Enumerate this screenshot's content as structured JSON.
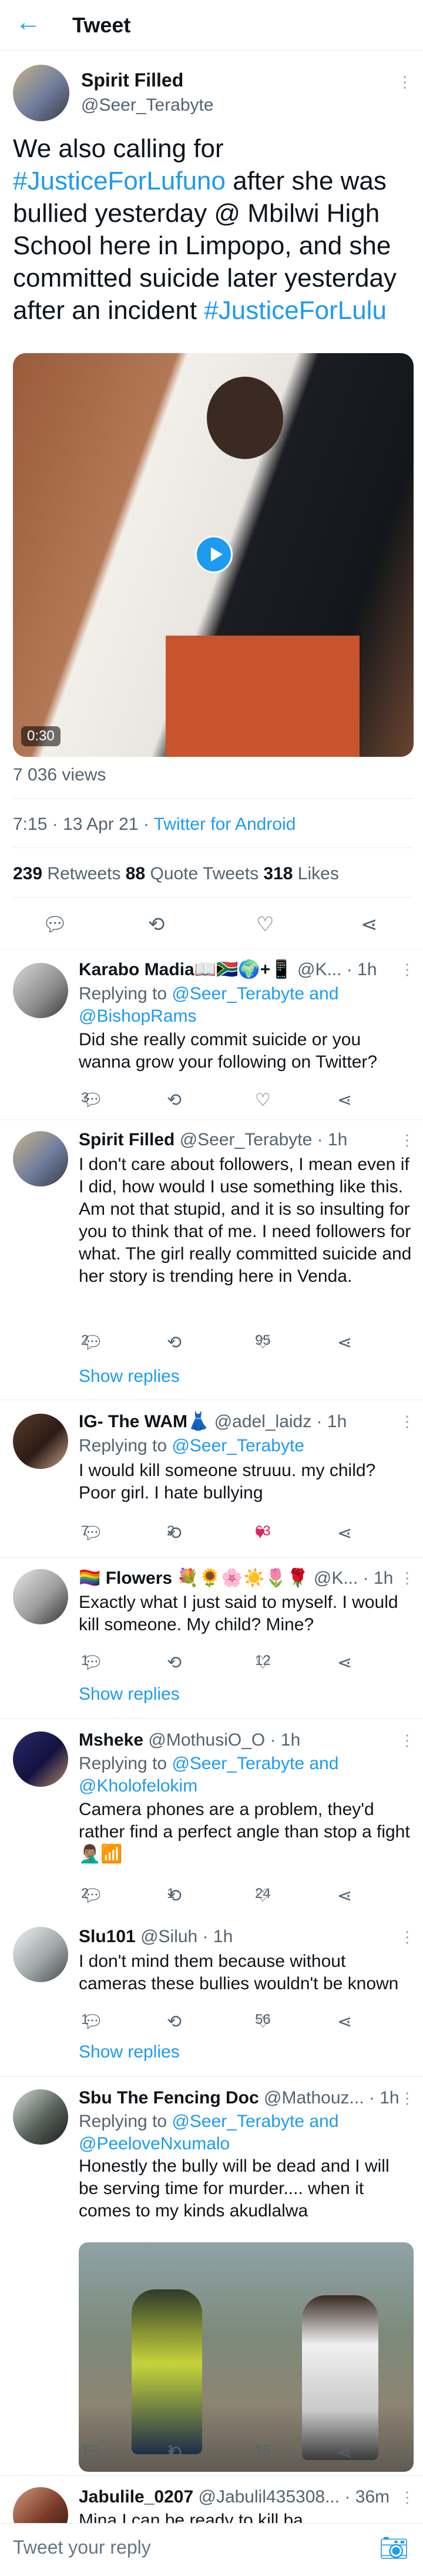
{
  "header": {
    "title": "Tweet",
    "back_icon": "←"
  },
  "tweet": {
    "name": "Spirit Filled",
    "handle": "@Seer_Terabyte",
    "text_parts": [
      "We also calling for ",
      "#JusticeForLufuno",
      " after she was bullied yesterday @ Mbilwi High School here in Limpopo, and she committed suicide later yesterday after an incident ",
      "#JusticeForLulu"
    ],
    "video_duration": "0:30",
    "views": "7 036 views",
    "time": "7:15 · 13 Apr 21 · ",
    "client": "Twitter for Android",
    "retweets": "239",
    "retweets_label": " Retweets  ",
    "quotes": "88",
    "quotes_label": " Quote Tweets  ",
    "likes": "318",
    "likes_label": " Likes"
  },
  "replies": [
    {
      "name": "Karabo Madia📖🇿🇦🌍+📱",
      "handle": "@K... · 1h",
      "replying_prefix": "Replying to ",
      "replying_to": "@Seer_Terabyte and @BishopRams",
      "text": "Did she really commit suicide or you wanna grow your following on Twitter?",
      "reply_count": "3",
      "retweet_count": "",
      "like_count": ""
    },
    {
      "name": "Spirit Filled",
      "handle": "@Seer_Terabyte · 1h",
      "text": "I don't care about followers, I mean even if I did, how would I use something like this. Am not that stupid, and it is so insulting for you to think that of me. I need followers for what. The girl really committed suicide and her story is trending here in Venda.",
      "reply_count": "2",
      "retweet_count": "",
      "like_count": "95",
      "show_replies": "Show replies"
    },
    {
      "name": "IG- The WAM👗",
      "handle": "@adel_laidz · 1h",
      "replying_prefix": "Replying to ",
      "replying_to": "@Seer_Terabyte",
      "text": "I would kill someone struuu. my child? Poor girl. I hate bullying",
      "reply_count": "7",
      "retweet_count": "2",
      "like_count": "63"
    },
    {
      "name": "🏳️‍🌈 Flowers 💐🌻🌸☀️🌷🌹",
      "handle": "@K... · 1h",
      "text": "Exactly what I just said to myself. I would kill someone. My child? Mine?",
      "reply_count": "1",
      "retweet_count": "",
      "like_count": "12",
      "show_replies": "Show replies"
    },
    {
      "name": "Msheke",
      "handle": "@MothusiO_O · 1h",
      "replying_prefix": "Replying to ",
      "replying_to": "@Seer_Terabyte and @Kholofelokim",
      "text": "Camera phones are a problem, they'd rather find a perfect angle than stop a fight 🤦🏽‍♂️📶",
      "reply_count": "2",
      "retweet_count": "1",
      "like_count": "24"
    },
    {
      "name": "Slu101",
      "handle": "@Siluh · 1h",
      "text": "I don't mind them because without cameras these bullies wouldn't be known",
      "reply_count": "1",
      "retweet_count": "",
      "like_count": "56",
      "show_replies": "Show replies"
    },
    {
      "name": "Sbu The Fencing Doc",
      "handle": "@Mathouz... · 1h",
      "replying_prefix": "Replying to ",
      "replying_to": "@Seer_Terabyte and @PeeloveNxumalo",
      "text": "Honestly the bully will be dead and I will be serving time for murder.... when it comes to my kinds akudlalwa",
      "reply_count": "1",
      "retweet_count": "1",
      "like_count": "15"
    },
    {
      "name": "Jabulile_0207",
      "handle": "@Jabulil435308... · 36m",
      "text": "Mina I can be ready to kill ba..."
    }
  ],
  "compose": {
    "placeholder": "Tweet your reply"
  },
  "icons": {
    "reply": "reply-icon",
    "retweet": "retweet-icon",
    "like": "heart-icon",
    "share": "share-icon",
    "more": "more-icon",
    "camera": "camera-icon"
  },
  "colors": {
    "accent": "#1d9bf0",
    "liked": "#e0245e",
    "muted": "#536471"
  }
}
